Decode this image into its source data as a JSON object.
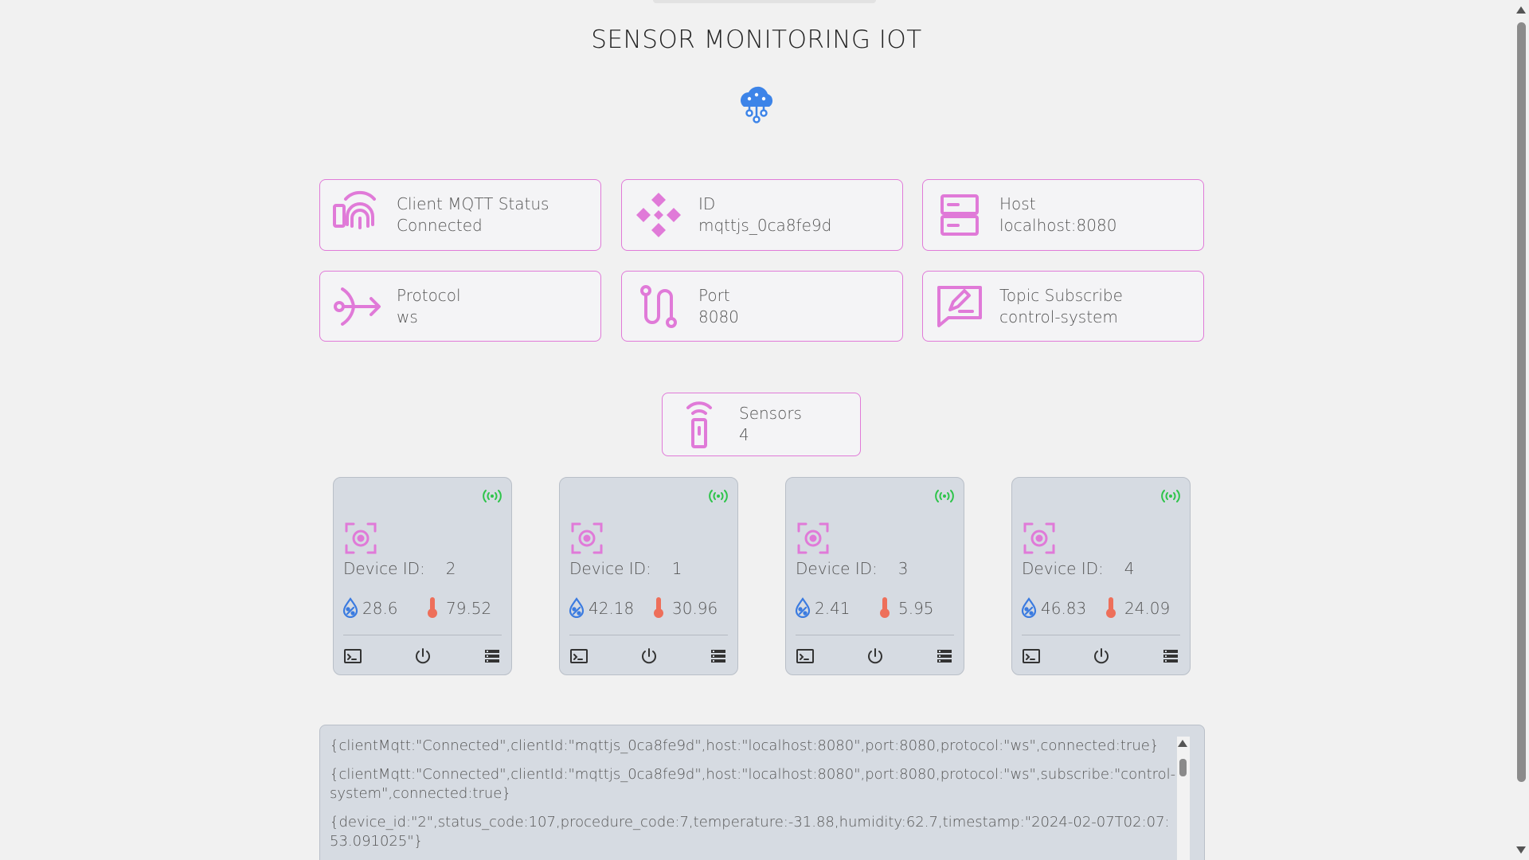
{
  "page": {
    "title": "SENSOR MONITORING IOT",
    "logo_icon": "cloud-network-icon"
  },
  "info_cards": [
    {
      "label": "Client MQTT Status",
      "value": "Connected",
      "icon": "broadcast-device-icon"
    },
    {
      "label": "ID",
      "value": "mqttjs_0ca8fe9d",
      "icon": "diamond-arrows-icon"
    },
    {
      "label": "Host",
      "value": "localhost:8080",
      "icon": "server-icon"
    },
    {
      "label": "Protocol",
      "value": "ws",
      "icon": "protocol-fork-icon"
    },
    {
      "label": "Port",
      "value": "8080",
      "icon": "route-icon"
    },
    {
      "label": "Topic Subscribe",
      "value": "control-system",
      "icon": "message-edit-icon"
    }
  ],
  "sensors_summary": {
    "label": "Sensors",
    "value": "4",
    "icon": "remote-sensor-icon"
  },
  "device_label": "Device ID:",
  "devices": [
    {
      "id": "2",
      "humidity": "28.6",
      "temperature": "79.52"
    },
    {
      "id": "1",
      "humidity": "42.18",
      "temperature": "30.96"
    },
    {
      "id": "3",
      "humidity": "2.41",
      "temperature": "5.95"
    },
    {
      "id": "4",
      "humidity": "46.83",
      "temperature": "24.09"
    }
  ],
  "device_actions": [
    "terminal-icon",
    "power-icon",
    "list-icon"
  ],
  "colors": {
    "accent": "#e07ad8",
    "online": "#2ec44a",
    "humidity": "#3b7be0",
    "temperature": "#ee6f5a",
    "logo": "#3d84e8"
  },
  "console_lines": [
    "{clientMqtt:\"Connected\",clientId:\"mqttjs_0ca8fe9d\",host:\"localhost:8080\",port:8080,protocol:\"ws\",connected:true}",
    "{clientMqtt:\"Connected\",clientId:\"mqttjs_0ca8fe9d\",host:\"localhost:8080\",port:8080,protocol:\"ws\",subscribe:\"control-system\",connected:true}",
    "{device_id:\"2\",status_code:107,procedure_code:7,temperature:-31.88,humidity:62.7,timestamp:\"2024-02-07T02:07:53.091025\"}"
  ]
}
